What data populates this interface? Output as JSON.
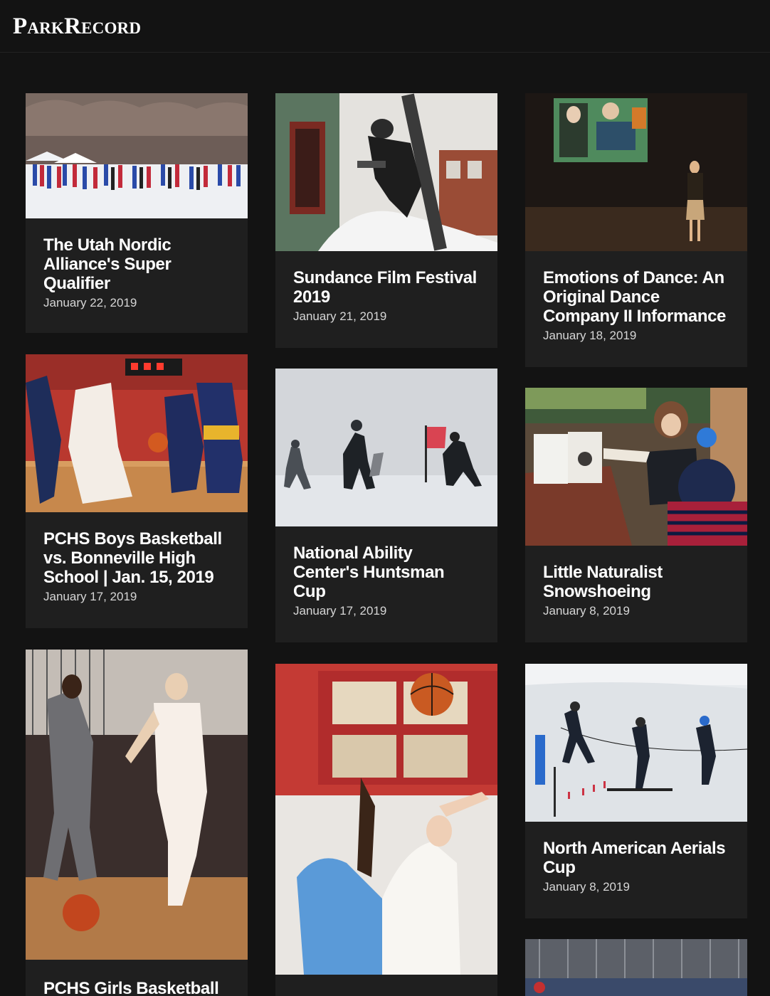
{
  "site": {
    "logo": "ParkRecord"
  },
  "gallery": {
    "cards": [
      {
        "photo": "nordic-ski-race-start-photo",
        "title": "The Utah Nordic Alliance's Super Qualifier",
        "date": "January 22, 2019"
      },
      {
        "photo": "sundance-sign-install-photo",
        "title": "Sundance Film Festival 2019",
        "date": "January 21, 2019"
      },
      {
        "photo": "dance-stage-speaker-photo",
        "title": "Emotions of Dance: An Original Dance Company II Informance",
        "date": "January 18, 2019"
      },
      {
        "photo": "boys-basketball-photo",
        "title": "PCHS Boys Basketball vs. Bonneville High School | Jan. 15, 2019",
        "date": "January 17, 2019"
      },
      {
        "photo": "snowy-slalom-race-photo",
        "title": "National Ability Center's Huntsman Cup",
        "date": "January 17, 2019"
      },
      {
        "photo": "naturalist-reading-photo",
        "title": "Little Naturalist Snowshoeing",
        "date": "January 8, 2019"
      },
      {
        "photo": "girls-basketball-dribble-photo",
        "title": "PCHS Girls Basketball",
        "date": ""
      },
      {
        "photo": "basketball-tipoff-photo",
        "title": "",
        "date": ""
      },
      {
        "photo": "aerials-skiers-photo",
        "title": "North American Aerials Cup",
        "date": "January 8, 2019"
      },
      {
        "photo": "arena-partial-photo",
        "title": "",
        "date": ""
      }
    ]
  }
}
